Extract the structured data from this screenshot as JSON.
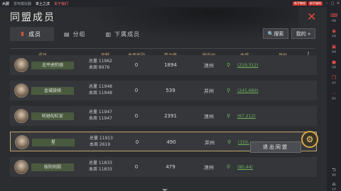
{
  "emulator": {
    "app_name": "大屏",
    "tabs": [
      "雷电模拟器",
      "率土之滨"
    ],
    "red_tab": "关于我们",
    "btn1": "新手教程",
    "btn2": "新手福利"
  },
  "window": {
    "title": "同盟成员",
    "close_label": "✕"
  },
  "tabs": [
    {
      "label": "成员",
      "icon": "♜"
    },
    {
      "label": "分组",
      "icon": "▤"
    },
    {
      "label": "下属成员",
      "icon": "▥"
    }
  ],
  "toolbar": {
    "search_label": "🔍搜索",
    "mine_label": "我的 »"
  },
  "columns": {
    "member": "成员",
    "contribution": "贡献",
    "weekly_merit": "本周武勋",
    "power": "势力值",
    "region": "所在州",
    "villa": "主城",
    "title": "身份",
    "help": "?"
  },
  "rows": [
    {
      "name": "北平虎豹骑",
      "total": "总量 11962",
      "week": "本周 8976",
      "merit": "0",
      "power": "1894",
      "region": "凉州",
      "villa": "(219,312)"
    },
    {
      "name": "金城骁骑",
      "total": "总量 11948",
      "week": "本周 11948",
      "merit": "0",
      "power": "539",
      "region": "并州",
      "villa": "(245,689)"
    },
    {
      "name": "听她勾栏安",
      "total": "总量 11947",
      "week": "本周 11947",
      "merit": "0",
      "power": "2391",
      "region": "凉州",
      "villa": "(67,212)"
    },
    {
      "name": "星",
      "total": "总量 11913",
      "week": "本周 2619",
      "merit": "0",
      "power": "490",
      "region": "并州",
      "villa": "(150,"
    },
    {
      "name": "枝阳何厕",
      "total": "总量 11833",
      "week": "本周 11833",
      "merit": "0",
      "power": "479",
      "region": "凉州",
      "villa": "(80,44)"
    }
  ],
  "popup": {
    "exit_label": "退出同盟",
    "gear_icon": "⚙"
  },
  "sidebar": {
    "items": [
      "键盘",
      "手柄",
      "截屏",
      "录屏",
      "多开",
      "更多",
      "返回",
      "主页"
    ]
  }
}
